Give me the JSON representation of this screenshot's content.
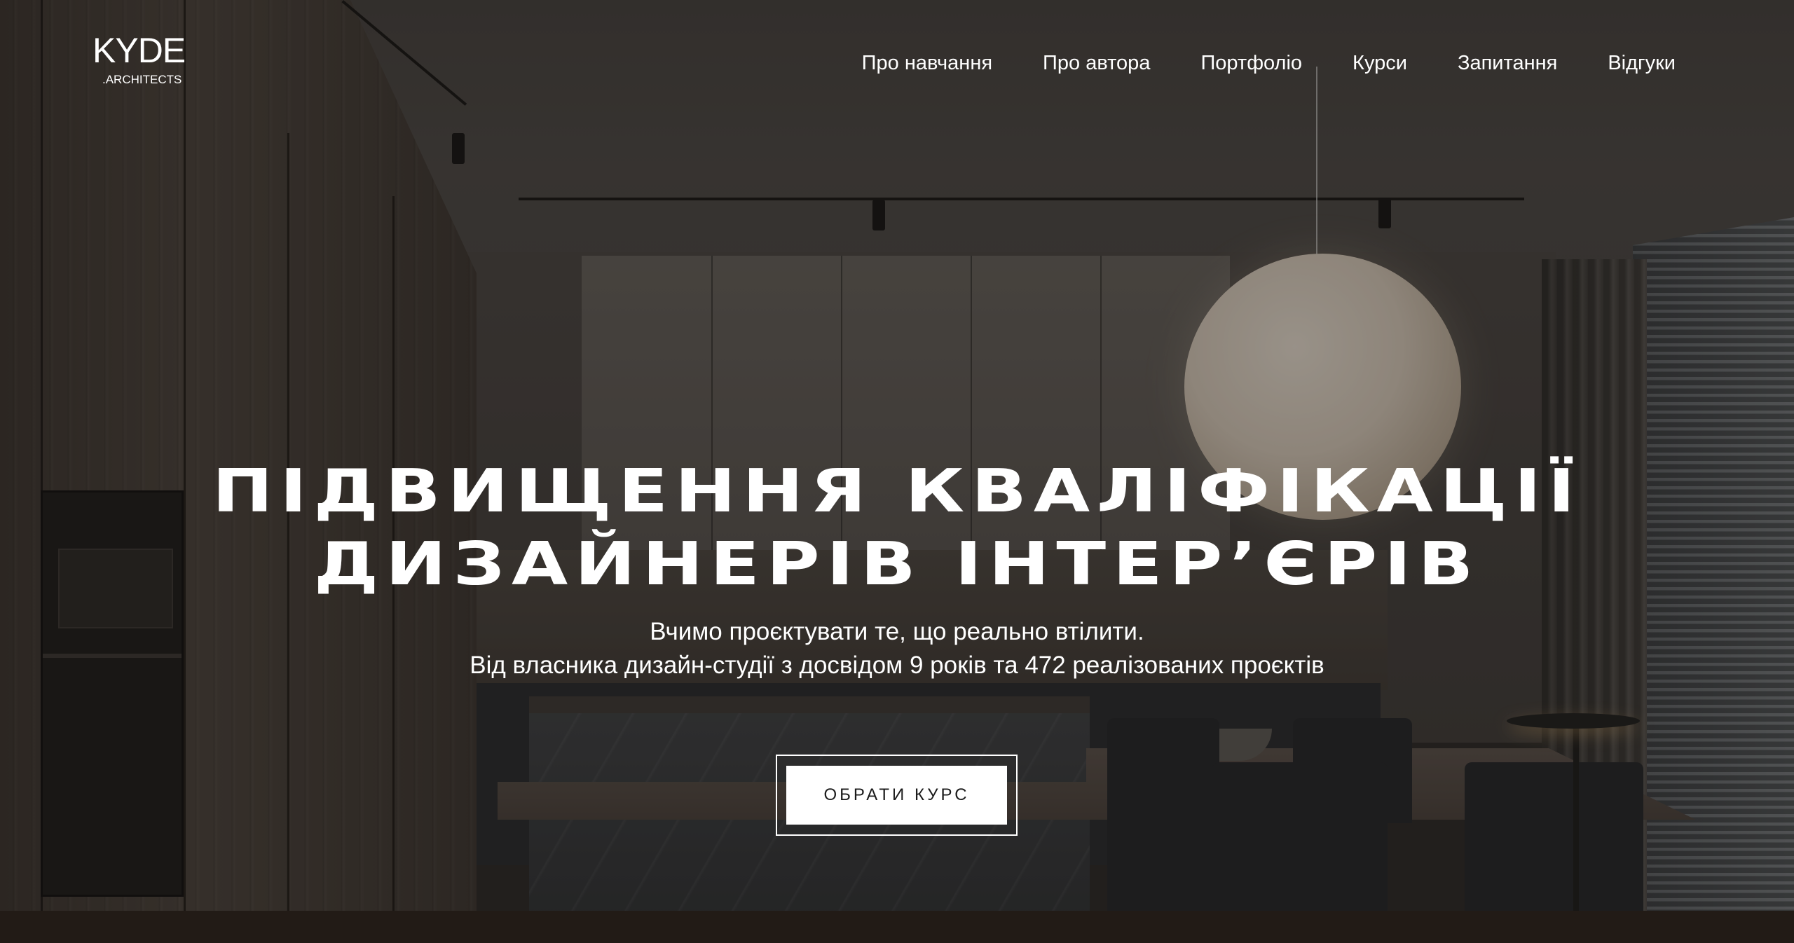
{
  "logo": {
    "main": "KYDE",
    "sub": ".ARCHITECTS"
  },
  "nav": {
    "items": [
      {
        "label": "Про навчання"
      },
      {
        "label": "Про автора"
      },
      {
        "label": "Портфоліо"
      },
      {
        "label": "Курси"
      },
      {
        "label": "Запитання"
      },
      {
        "label": "Відгуки"
      }
    ]
  },
  "hero": {
    "title_line1": "ПІДВИЩЕННЯ КВАЛІФІКАЦІЇ",
    "title_line2": "ДИЗАЙНЕРІВ ІНТЕР’ЄРІВ",
    "subtitle_line1": "Вчимо проєктувати те, що реально втілити.",
    "subtitle_line2": "Від власника дизайн-студії з досвідом 9 років та 472 реалізованих проєктів",
    "cta_label": "ОБРАТИ КУРС"
  },
  "colors": {
    "text": "#ffffff",
    "button_bg": "#ffffff",
    "button_text": "#1a1a1a",
    "overlay": "#141211"
  }
}
